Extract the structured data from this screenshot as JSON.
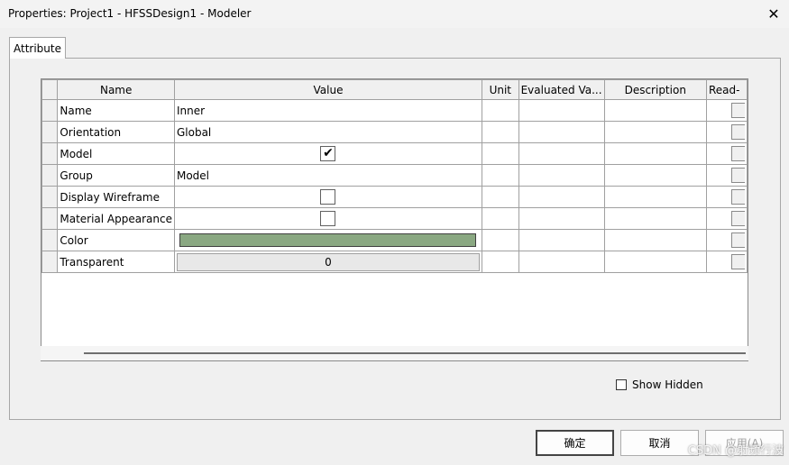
{
  "window": {
    "title": "Properties: Project1 - HFSSDesign1 - Modeler",
    "close_glyph": "✕"
  },
  "tabs": [
    {
      "label": "Attribute"
    }
  ],
  "grid": {
    "columns": [
      "Name",
      "Value",
      "Unit",
      "Evaluated Va...",
      "Description",
      "Read-"
    ],
    "rows": [
      {
        "name": "Name",
        "type": "text",
        "value": "Inner"
      },
      {
        "name": "Orientation",
        "type": "text",
        "value": "Global"
      },
      {
        "name": "Model",
        "type": "checkbox",
        "checked": true
      },
      {
        "name": "Group",
        "type": "text",
        "value": "Model"
      },
      {
        "name": "Display Wireframe",
        "type": "checkbox",
        "checked": false
      },
      {
        "name": "Material Appearance",
        "type": "checkbox",
        "checked": false
      },
      {
        "name": "Color",
        "type": "color",
        "color": "#8aa882"
      },
      {
        "name": "Transparent",
        "type": "button",
        "value": "0"
      }
    ]
  },
  "show_hidden": {
    "label": "Show Hidden",
    "checked": false
  },
  "buttons": {
    "ok": "确定",
    "cancel": "取消",
    "apply": "应用(A)"
  },
  "watermark": "CSDN @射频行波"
}
